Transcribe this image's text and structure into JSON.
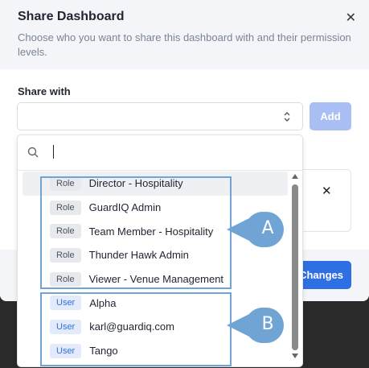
{
  "modal": {
    "title": "Share Dashboard",
    "subtitle": "Choose who you want to share this dashboard with and their permission levels.",
    "close_icon": "close-icon"
  },
  "share": {
    "label": "Share with",
    "select_value": "",
    "add_label": "Add"
  },
  "footer": {
    "save_label": "Changes"
  },
  "dropdown": {
    "search_value": "",
    "items": [
      {
        "badge": "Role",
        "label": "Director - Hospitality"
      },
      {
        "badge": "Role",
        "label": "GuardIQ Admin"
      },
      {
        "badge": "Role",
        "label": "Team Member - Hospitality"
      },
      {
        "badge": "Role",
        "label": "Thunder Hawk Admin"
      },
      {
        "badge": "Role",
        "label": "Viewer - Venue Management"
      },
      {
        "badge": "User",
        "label": "Alpha"
      },
      {
        "badge": "User",
        "label": "karl@guardiq.com"
      },
      {
        "badge": "User",
        "label": "Tango"
      }
    ]
  },
  "annotations": {
    "a": "A",
    "b": "B"
  },
  "colors": {
    "accent": "#2f6fe4",
    "add_disabled": "#a9bff4",
    "callout": "#6fa4d4"
  }
}
